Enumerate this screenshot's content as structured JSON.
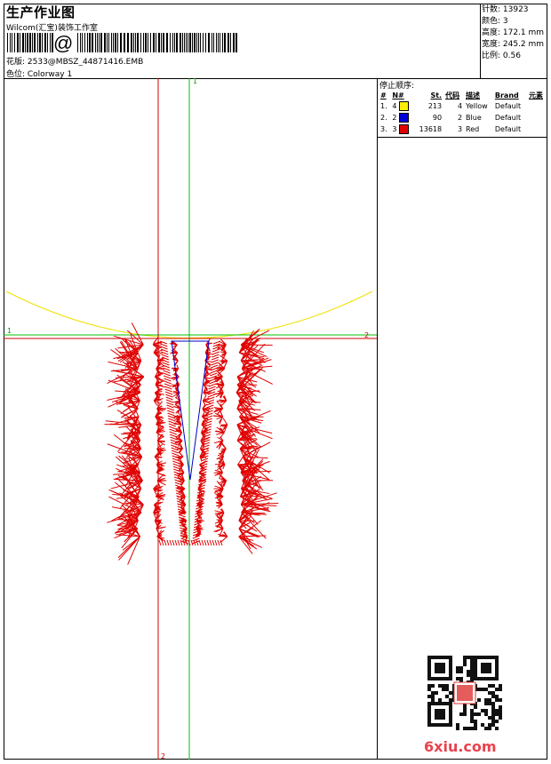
{
  "header": {
    "title": "生产作业图",
    "studio": "Wilcom(汇宝)装饰工作室",
    "design_line": "花版: 2533@MBSZ_44871416.EMB",
    "colorway_line": "色位: Colorway 1"
  },
  "stats": {
    "stitches": "针数: 13923",
    "colors": "颜色: 3",
    "height": "高度: 172.1 mm",
    "width": "宽度: 245.2 mm",
    "scale": "比例: 0.56"
  },
  "stop_sequence": {
    "label": "停止顺序:",
    "headers": [
      "#",
      "N#",
      "St.",
      "代码",
      "描述",
      "Brand",
      "元素"
    ],
    "rows": [
      {
        "num": "1.",
        "n": "4",
        "color": "#ffee00",
        "st": "213",
        "code": "4",
        "desc": "Yellow",
        "brand": "Default"
      },
      {
        "num": "2.",
        "n": "2",
        "color": "#0000d8",
        "st": "90",
        "code": "2",
        "desc": "Blue",
        "brand": "Default"
      },
      {
        "num": "3.",
        "n": "3",
        "color": "#e00000",
        "st": "13618",
        "code": "3",
        "desc": "Red",
        "brand": "Default"
      }
    ]
  },
  "axes": {
    "vertical_green": "1",
    "horizontal_green": "1",
    "horizontal_red": "2",
    "vertical_red": "2"
  },
  "colors": {
    "stitch_red": "#e00000",
    "stitch_blue": "#0000c8",
    "stitch_yellow": "#f0e000",
    "guide_green": "#00c000",
    "guide_red": "#d00000"
  },
  "watermark": "6xiu.com"
}
